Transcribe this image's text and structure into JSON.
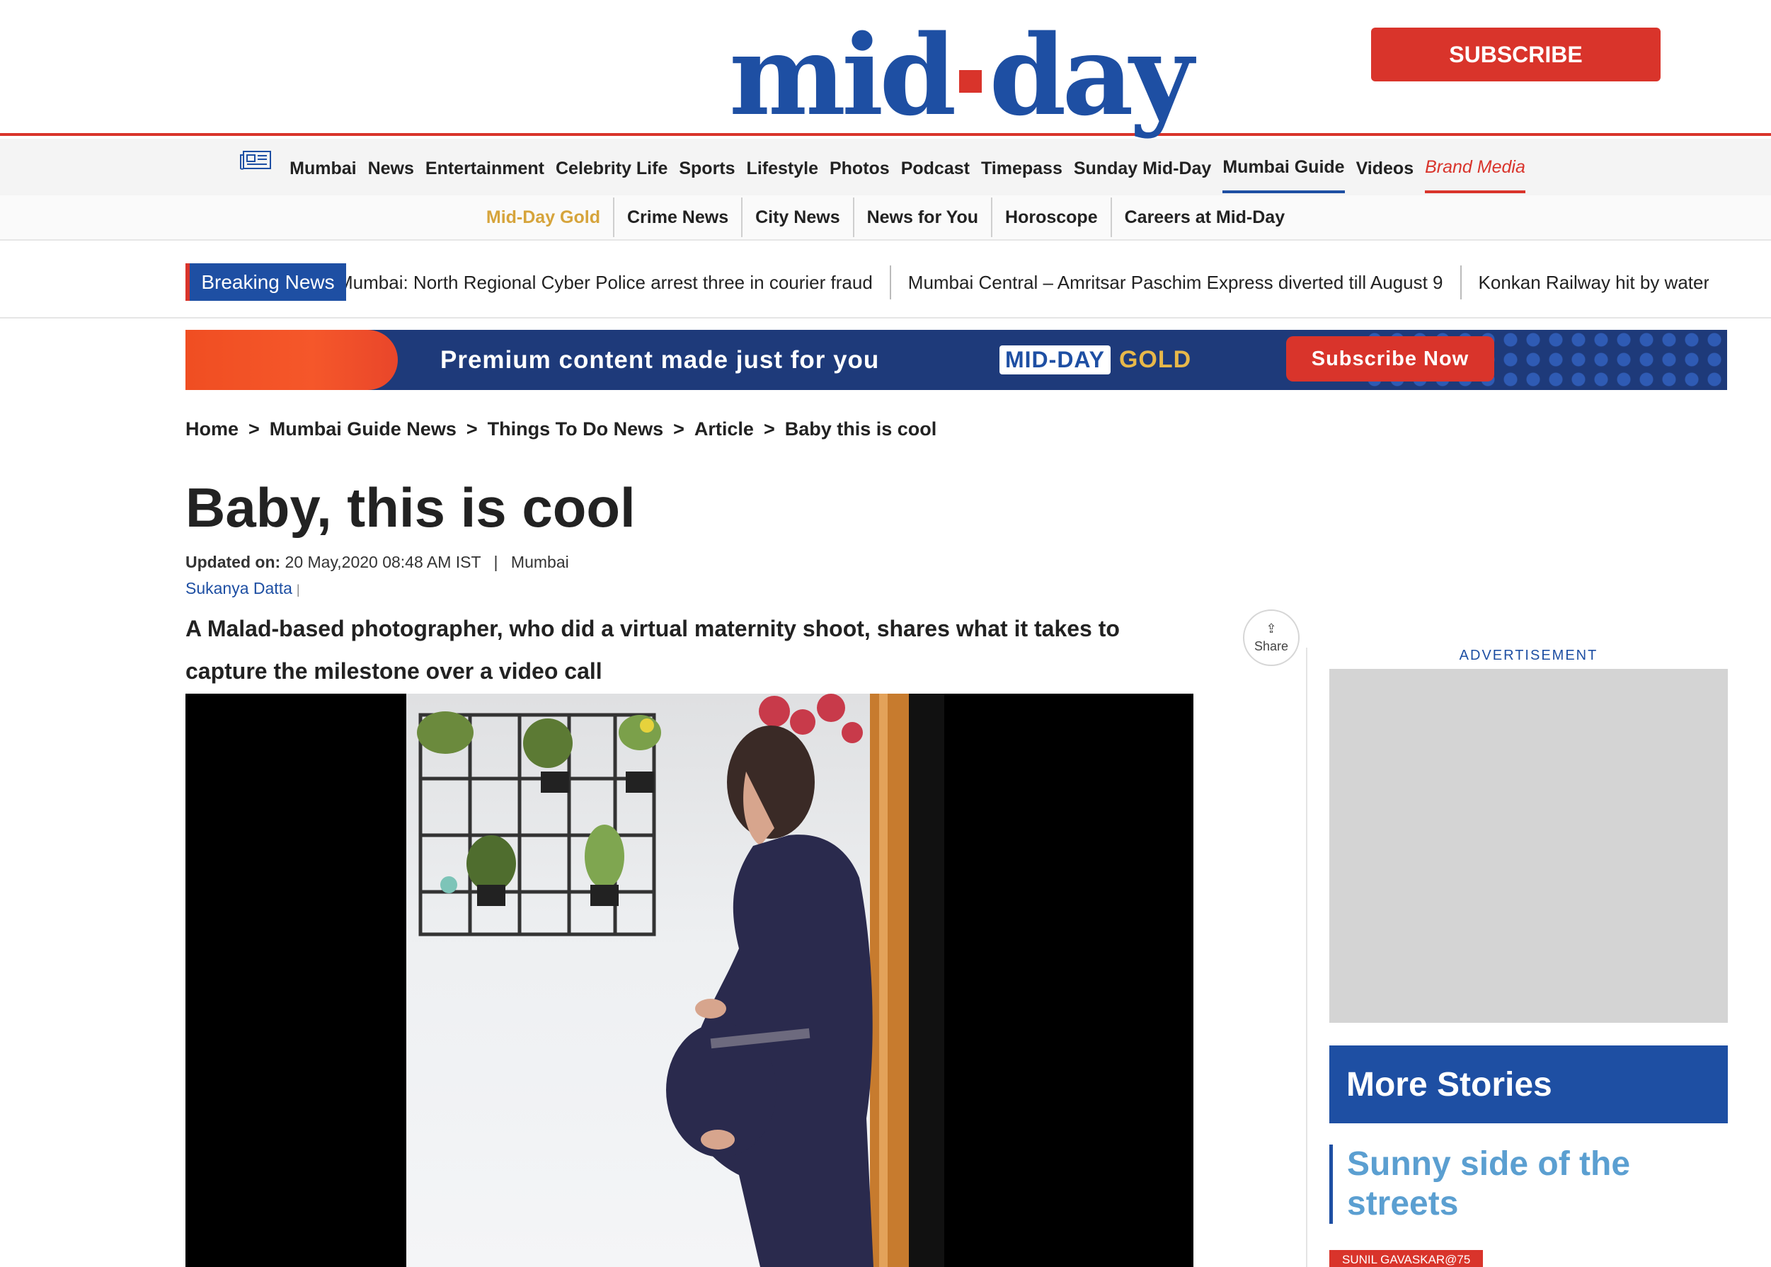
{
  "header": {
    "logo_left": "mid",
    "logo_right": "day",
    "subscribe_label": "SUBSCRIBE"
  },
  "main_nav": {
    "items": [
      "Mumbai",
      "News",
      "Entertainment",
      "Celebrity Life",
      "Sports",
      "Lifestyle",
      "Photos",
      "Podcast",
      "Timepass",
      "Sunday Mid-Day",
      "Mumbai Guide",
      "Videos",
      "Brand Media"
    ],
    "active": "Mumbai Guide"
  },
  "sub_nav": {
    "items": [
      "Mid-Day Gold",
      "Crime News",
      "City News",
      "News for You",
      "Horoscope",
      "Careers at Mid-Day"
    ]
  },
  "breaking_news": {
    "label": "Breaking News",
    "items": [
      "Mumbai: North Regional Cyber Police arrest three in courier fraud",
      "Mumbai Central – Amritsar Paschim Express diverted till August 9",
      "Konkan Railway hit by water"
    ]
  },
  "promo_banner": {
    "text": "Premium content made just for you",
    "brand": "MID-DAY",
    "brand_suffix": "GOLD",
    "cta": "Subscribe Now"
  },
  "breadcrumb": [
    "Home",
    "Mumbai Guide News",
    "Things To Do News",
    "Article",
    "Baby this is cool"
  ],
  "article": {
    "title": "Baby, this is cool",
    "updated_label": "Updated on:",
    "updated_value": "20 May,2020 08:48 AM IST",
    "location": "Mumbai",
    "author": "Sukanya Datta",
    "summary": "A Malad-based photographer, who did a virtual maternity shoot, shares what it takes to capture the milestone over a video call",
    "share_label": "Share"
  },
  "sidebar": {
    "ad_label": "ADVERTISEMENT",
    "more_stories_title": "More Stories",
    "story_title": "Sunny side of the streets",
    "story_tag": "SUNIL GAVASKAR@75"
  },
  "colors": {
    "brand_blue": "#1e4fa3",
    "brand_red": "#d9342b",
    "gold": "#d6a43b",
    "story_link": "#5b9fd1"
  }
}
